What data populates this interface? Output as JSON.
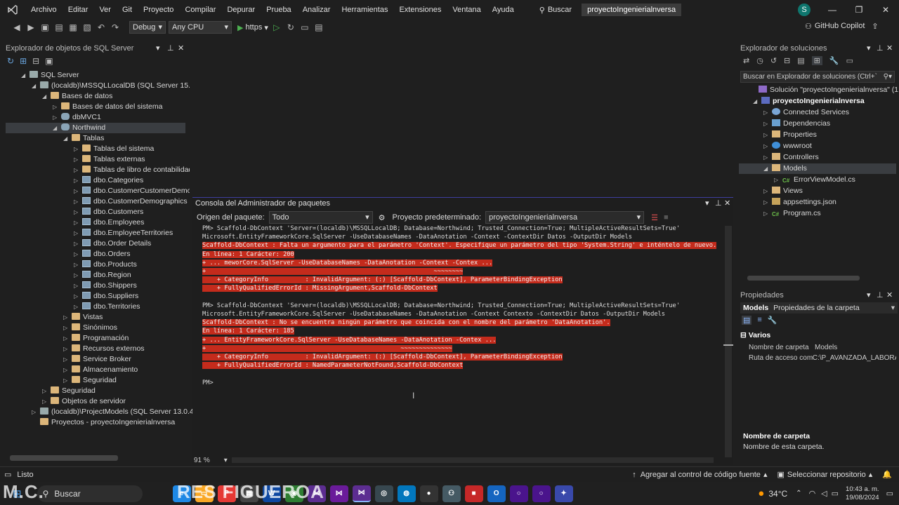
{
  "menubar": {
    "items": [
      "Archivo",
      "Editar",
      "Ver",
      "Git",
      "Proyecto",
      "Compilar",
      "Depurar",
      "Prueba",
      "Analizar",
      "Herramientas",
      "Extensiones",
      "Ventana",
      "Ayuda"
    ],
    "search_label": "Buscar",
    "solution_name": "proyectoIngenierialnversa",
    "avatar_letter": "S"
  },
  "toolbar": {
    "config": "Debug",
    "platform": "Any CPU",
    "run_target": "https",
    "copilot": "GitHub Copilot"
  },
  "sql_explorer": {
    "title": "Explorador de objetos de SQL Server",
    "rows": [
      {
        "label": "SQL Server",
        "level": 1,
        "icon": "server",
        "arrow": "down"
      },
      {
        "label": "(localdb)\\MSSQLLocalDB (SQL Server 15.0.41",
        "level": 2,
        "icon": "server",
        "arrow": "down"
      },
      {
        "label": "Bases de datos",
        "level": 3,
        "icon": "folder",
        "arrow": "down"
      },
      {
        "label": "Bases de datos del sistema",
        "level": 4,
        "icon": "folder",
        "arrow": "right"
      },
      {
        "label": "dbMVC1",
        "level": 4,
        "icon": "db",
        "arrow": "right"
      },
      {
        "label": "Northwind",
        "level": 4,
        "icon": "db",
        "arrow": "down",
        "selected": true
      },
      {
        "label": "Tablas",
        "level": 5,
        "icon": "folder",
        "arrow": "down"
      },
      {
        "label": "Tablas del sistema",
        "level": 6,
        "icon": "folder",
        "arrow": "right"
      },
      {
        "label": "Tablas externas",
        "level": 6,
        "icon": "folder",
        "arrow": "right"
      },
      {
        "label": "Tablas de libro de contabilidad",
        "level": 6,
        "icon": "folder",
        "arrow": "right"
      },
      {
        "label": "dbo.Categories",
        "level": 6,
        "icon": "table",
        "arrow": "right"
      },
      {
        "label": "dbo.CustomerCustomerDemo",
        "level": 6,
        "icon": "table",
        "arrow": "right"
      },
      {
        "label": "dbo.CustomerDemographics",
        "level": 6,
        "icon": "table",
        "arrow": "right"
      },
      {
        "label": "dbo.Customers",
        "level": 6,
        "icon": "table",
        "arrow": "right"
      },
      {
        "label": "dbo.Employees",
        "level": 6,
        "icon": "table",
        "arrow": "right"
      },
      {
        "label": "dbo.EmployeeTerritories",
        "level": 6,
        "icon": "table",
        "arrow": "right"
      },
      {
        "label": "dbo.Order Details",
        "level": 6,
        "icon": "table",
        "arrow": "right"
      },
      {
        "label": "dbo.Orders",
        "level": 6,
        "icon": "table",
        "arrow": "right"
      },
      {
        "label": "dbo.Products",
        "level": 6,
        "icon": "table",
        "arrow": "right"
      },
      {
        "label": "dbo.Region",
        "level": 6,
        "icon": "table",
        "arrow": "right"
      },
      {
        "label": "dbo.Shippers",
        "level": 6,
        "icon": "table",
        "arrow": "right"
      },
      {
        "label": "dbo.Suppliers",
        "level": 6,
        "icon": "table",
        "arrow": "right"
      },
      {
        "label": "dbo.Territories",
        "level": 6,
        "icon": "table",
        "arrow": "right"
      },
      {
        "label": "Vistas",
        "level": 5,
        "icon": "folder",
        "arrow": "right"
      },
      {
        "label": "Sinónimos",
        "level": 5,
        "icon": "folder",
        "arrow": "right"
      },
      {
        "label": "Programación",
        "level": 5,
        "icon": "folder",
        "arrow": "right"
      },
      {
        "label": "Recursos externos",
        "level": 5,
        "icon": "folder",
        "arrow": "right"
      },
      {
        "label": "Service Broker",
        "level": 5,
        "icon": "folder",
        "arrow": "right"
      },
      {
        "label": "Almacenamiento",
        "level": 5,
        "icon": "folder",
        "arrow": "right"
      },
      {
        "label": "Seguridad",
        "level": 5,
        "icon": "folder",
        "arrow": "right"
      },
      {
        "label": "Seguridad",
        "level": 3,
        "icon": "folder",
        "arrow": "right"
      },
      {
        "label": "Objetos de servidor",
        "level": 3,
        "icon": "folder",
        "arrow": "right"
      },
      {
        "label": "(localdb)\\ProjectModels (SQL Server 13.0.400",
        "level": 2,
        "icon": "server",
        "arrow": "right"
      },
      {
        "label": "Proyectos - proyectoIngenierialnversa",
        "level": 2,
        "icon": "folder",
        "arrow": "none"
      }
    ]
  },
  "console": {
    "title": "Consola del Administrador de paquetes",
    "source_label": "Origen del paquete:",
    "source_value": "Todo",
    "project_label": "Proyecto predeterminado:",
    "project_value": "proyectoIngenierialnversa",
    "zoom": "91 %",
    "lines": [
      {
        "text": "PM> Scaffold-DbContext 'Server=(localdb)\\MSSQLLocalDB; Database=Northwind; Trusted_Connection=True; MultipleActiveResultSets=True'",
        "err": false
      },
      {
        "text": "Microsoft.EntityFrameworkCore.SqlServer -UseDatabaseNames -DataAnotation -Context -ContextDir Datos -OutputDir Models",
        "err": false
      },
      {
        "text": "Scaffold-DbContext : Falta un argumento para el parámetro 'Context'. Especifique un parámetro del tipo 'System.String' e inténtelo de nuevo.",
        "err": true
      },
      {
        "text": "En línea: 1 Carácter: 200",
        "err": true
      },
      {
        "text": "+ ... meworCore.SqlServer -UseDatabaseNames -DataAnotation -Context -Contex ...",
        "err": true
      },
      {
        "text": "+                                                              ~~~~~~~~",
        "err": true
      },
      {
        "text": "    + CategoryInfo          : InvalidArgument: (:) [Scaffold-DbContext], ParameterBindingException",
        "err": true
      },
      {
        "text": "    + FullyQualifiedErrorId : MissingArgument,Scaffold-DbContext",
        "err": true
      },
      {
        "text": "",
        "err": false
      },
      {
        "text": "PM> Scaffold-DbContext 'Server=(localdb)\\MSSQLLocalDB; Database=Northwind; Trusted_Connection=True; MultipleActiveResultSets=True'",
        "err": false
      },
      {
        "text": "Microsoft.EntityFrameworkCore.SqlServer -UseDatabaseNames -DataAnotation -Context Contexto -ContextDir Datos -OutputDir Models",
        "err": false
      },
      {
        "text": "Scaffold-DbContext : No se encuentra ningún parámetro que coincida con el nombre del parámetro 'DataAnotation'.",
        "err": true
      },
      {
        "text": "En línea: 1 Carácter: 185",
        "err": true
      },
      {
        "text": "+ ... EntityFrameworkCore.SqlServer -UseDatabaseNames -DataAnotation -Contex ...",
        "err": true
      },
      {
        "text": "+                                                     ~~~~~~~~~~~~~~",
        "err": true
      },
      {
        "text": "    + CategoryInfo          : InvalidArgument: (:) [Scaffold-DbContext], ParameterBindingException",
        "err": true
      },
      {
        "text": "    + FullyQualifiedErrorId : NamedParameterNotFound,Scaffold-DbContext",
        "err": true
      },
      {
        "text": "",
        "err": false
      },
      {
        "text": "PM>",
        "err": false
      }
    ]
  },
  "solution_explorer": {
    "title": "Explorador de soluciones",
    "search_placeholder": "Buscar en Explorador de soluciones (Ctrl+`",
    "rows": [
      {
        "label": "Solución \"proyectoIngenierialnversa\" (1 de",
        "level": 1,
        "icon": "solution",
        "arrow": "none"
      },
      {
        "label": "proyectoIngenierialnversa",
        "level": 1,
        "icon": "project",
        "arrow": "down",
        "bold": true
      },
      {
        "label": "Connected Services",
        "level": 2,
        "icon": "service",
        "arrow": "right"
      },
      {
        "label": "Dependencias",
        "level": 2,
        "icon": "deps",
        "arrow": "right"
      },
      {
        "label": "Properties",
        "level": 2,
        "icon": "folder",
        "arrow": "right"
      },
      {
        "label": "wwwroot",
        "level": 2,
        "icon": "globe",
        "arrow": "right"
      },
      {
        "label": "Controllers",
        "level": 2,
        "icon": "folder",
        "arrow": "right"
      },
      {
        "label": "Models",
        "level": 2,
        "icon": "folder",
        "arrow": "down",
        "selected": true
      },
      {
        "label": "ErrorViewModel.cs",
        "level": 3,
        "icon": "cs",
        "arrow": "right"
      },
      {
        "label": "Views",
        "level": 2,
        "icon": "folder",
        "arrow": "right"
      },
      {
        "label": "appsettings.json",
        "level": 2,
        "icon": "json",
        "arrow": "right"
      },
      {
        "label": "Program.cs",
        "level": 2,
        "icon": "cs",
        "arrow": "right"
      }
    ]
  },
  "properties": {
    "title": "Propiedades",
    "object_name": "Models",
    "object_type": "Propiedades de la carpeta",
    "category": "Varios",
    "rows": [
      {
        "name": "Nombre de carpeta",
        "value": "Models"
      },
      {
        "name": "Ruta de acceso comp",
        "value": "C:\\P_AVANZADA_LABORA"
      }
    ],
    "desc_title": "Nombre de carpeta",
    "desc_text": "Nombre de esta carpeta."
  },
  "statusbar": {
    "ready": "Listo",
    "source_control": "Agregar al control de código fuente",
    "repo": "Seleccionar repositorio"
  },
  "taskbar": {
    "search": "Buscar",
    "temp": "34°C",
    "time": "10:43 a. m.",
    "date": "19/08/2024"
  },
  "watermark": {
    "left": "M.C.",
    "middle": "RES FIGUEROA"
  }
}
